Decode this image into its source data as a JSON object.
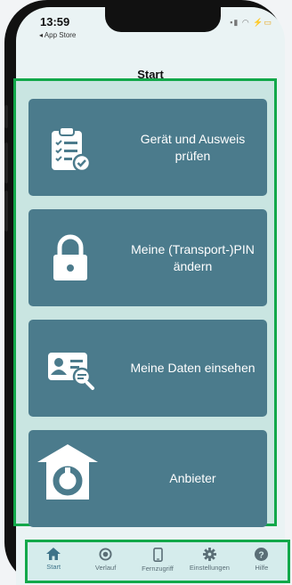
{
  "status_bar": {
    "time": "13:59",
    "back_app": "◂ App Store"
  },
  "nav": {
    "title": "Start"
  },
  "cards": [
    {
      "label": "Gerät und Ausweis prüfen",
      "icon": "clipboard-check-icon"
    },
    {
      "label": "Meine (Transport-)PIN ändern",
      "icon": "lock-icon"
    },
    {
      "label": "Meine Daten einsehen",
      "icon": "id-card-search-icon"
    },
    {
      "label": "Anbieter",
      "icon": "provider-house-icon"
    }
  ],
  "tabs": [
    {
      "label": "Start",
      "icon": "house-icon",
      "active": true
    },
    {
      "label": "Verlauf",
      "icon": "history-icon",
      "active": false
    },
    {
      "label": "Fernzugriff",
      "icon": "phone-icon",
      "active": false
    },
    {
      "label": "Einstellungen",
      "icon": "gear-icon",
      "active": false
    },
    {
      "label": "Hilfe",
      "icon": "help-icon",
      "active": false
    }
  ],
  "colors": {
    "card": "#4b7b8c",
    "content_bg": "#c9e5e1",
    "highlight_border": "#12a84a",
    "tab_active": "#3e7389"
  }
}
